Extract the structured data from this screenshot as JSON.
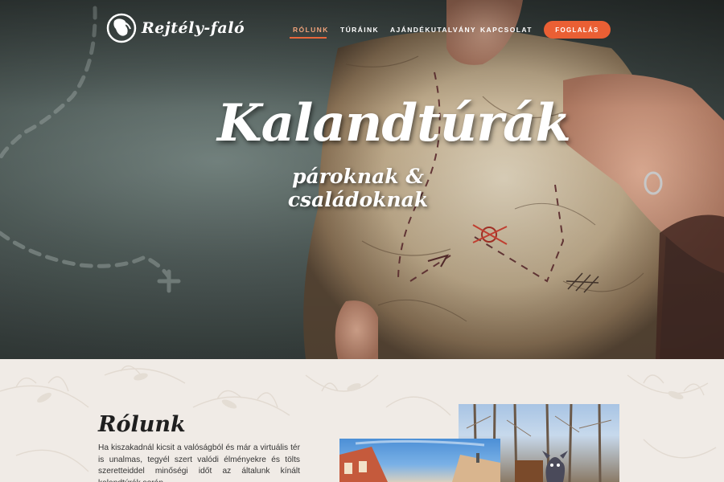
{
  "header": {
    "logo_text": "Rejtély-faló",
    "nav": [
      {
        "label": "RÓLUNK",
        "active": true
      },
      {
        "label": "TÚRÁINK",
        "active": false
      },
      {
        "label": "AJÁNDÉKUTALVÁNY",
        "active": false
      },
      {
        "label": "KAPCSOLAT",
        "active": false
      }
    ],
    "cta_label": "FOGLALÁS"
  },
  "hero": {
    "title": "Kalandtúrák",
    "subtitle": "pároknak & családoknak"
  },
  "about": {
    "title": "Rólunk",
    "text": "Ha kiszakadnál kicsit a valóságból és már a virtuális tér is unalmas, tegyél szert valódi élményekre és tölts szeretteiddel minőségi időt az általunk kínált kalandtúrák során."
  },
  "colors": {
    "accent": "#ea5f34",
    "page_bg": "#f0ebe6"
  },
  "icons": {
    "logo": "globe-horse-icon"
  }
}
